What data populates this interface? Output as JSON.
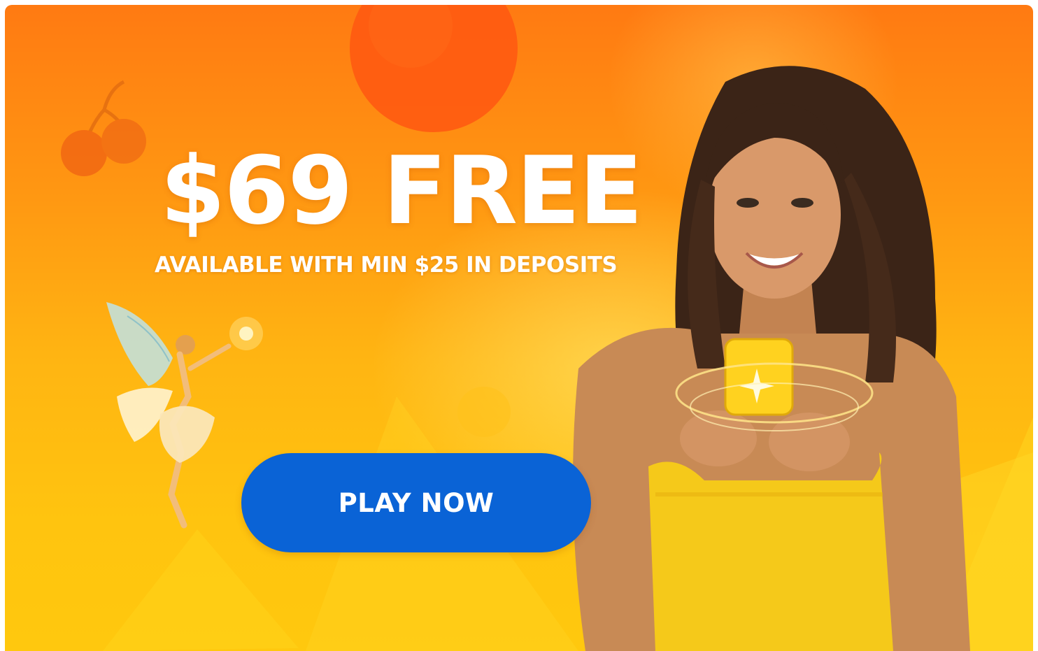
{
  "banner": {
    "headline": "$69 FREE",
    "subheadline": "AVAILABLE WITH MIN $25 IN DEPOSITS",
    "cta_label": "PLAY NOW"
  },
  "colors": {
    "background_top": "#ff7a12",
    "background_bottom": "#ffc80e",
    "cta": "#0a63d6",
    "text": "#ffffff"
  },
  "icons": [
    "cherries-icon",
    "orange-fruit-icon",
    "fairy-illustration",
    "woman-with-phone-photo"
  ]
}
